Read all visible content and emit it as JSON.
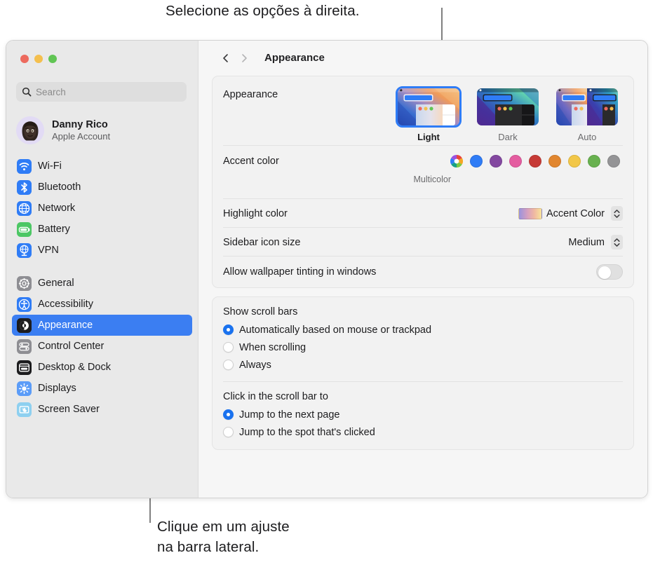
{
  "callouts": {
    "top": "Selecione as opções à direita.",
    "bottom_line1": "Clique em um ajuste",
    "bottom_line2": "na barra lateral."
  },
  "window": {
    "traffic_lights": {
      "close": "close-button",
      "minimize": "minimize-button",
      "maximize": "maximize-button"
    }
  },
  "sidebar": {
    "search": {
      "placeholder": "Search"
    },
    "account": {
      "name": "Danny Rico",
      "subtitle": "Apple Account"
    },
    "groups": [
      {
        "items": [
          {
            "label": "Wi-Fi",
            "icon": "wifi-icon",
            "selected": false
          },
          {
            "label": "Bluetooth",
            "icon": "bluetooth-icon",
            "selected": false
          },
          {
            "label": "Network",
            "icon": "network-icon",
            "selected": false
          },
          {
            "label": "Battery",
            "icon": "battery-icon",
            "selected": false
          },
          {
            "label": "VPN",
            "icon": "vpn-icon",
            "selected": false
          }
        ]
      },
      {
        "items": [
          {
            "label": "General",
            "icon": "gear-icon",
            "selected": false
          },
          {
            "label": "Accessibility",
            "icon": "accessibility-icon",
            "selected": false
          },
          {
            "label": "Appearance",
            "icon": "appearance-icon",
            "selected": true
          },
          {
            "label": "Control Center",
            "icon": "control-center-icon",
            "selected": false
          },
          {
            "label": "Desktop & Dock",
            "icon": "desktop-dock-icon",
            "selected": false
          },
          {
            "label": "Displays",
            "icon": "displays-icon",
            "selected": false
          },
          {
            "label": "Screen Saver",
            "icon": "screen-saver-icon",
            "selected": false
          }
        ]
      }
    ]
  },
  "toolbar": {
    "back": "back-chevron",
    "forward": "forward-chevron",
    "title": "Appearance"
  },
  "main": {
    "appearance": {
      "label": "Appearance",
      "modes": [
        {
          "label": "Light",
          "selected": true
        },
        {
          "label": "Dark",
          "selected": false
        },
        {
          "label": "Auto",
          "selected": false
        }
      ]
    },
    "accent": {
      "label": "Accent color",
      "selected_name": "Multicolor",
      "swatches": [
        {
          "name": "Multicolor",
          "color": "multicolor"
        },
        {
          "name": "Blue",
          "color": "#2f7cf6"
        },
        {
          "name": "Purple",
          "color": "#8348a0"
        },
        {
          "name": "Pink",
          "color": "#e45da0"
        },
        {
          "name": "Red",
          "color": "#c63a36"
        },
        {
          "name": "Orange",
          "color": "#e1862f"
        },
        {
          "name": "Yellow",
          "color": "#f2c748"
        },
        {
          "name": "Green",
          "color": "#68b14f"
        },
        {
          "name": "Graphite",
          "color": "#949496"
        }
      ]
    },
    "highlight": {
      "label": "Highlight color",
      "value": "Accent Color"
    },
    "sidebar_icon_size": {
      "label": "Sidebar icon size",
      "value": "Medium"
    },
    "wallpaper_tinting": {
      "label": "Allow wallpaper tinting in windows",
      "on": false
    },
    "scroll_bars": {
      "title": "Show scroll bars",
      "options": [
        {
          "label": "Automatically based on mouse or trackpad",
          "selected": true
        },
        {
          "label": "When scrolling",
          "selected": false
        },
        {
          "label": "Always",
          "selected": false
        }
      ]
    },
    "scroll_click": {
      "title": "Click in the scroll bar to",
      "options": [
        {
          "label": "Jump to the next page",
          "selected": true
        },
        {
          "label": "Jump to the spot that's clicked",
          "selected": false
        }
      ]
    }
  },
  "colors": {
    "accent": "#2f7cf6",
    "selection": "#3b7ef2",
    "window_bg": "#f6f6f6",
    "sidebar_bg": "#e9e9e9",
    "card_bg": "#f2f2f2"
  }
}
